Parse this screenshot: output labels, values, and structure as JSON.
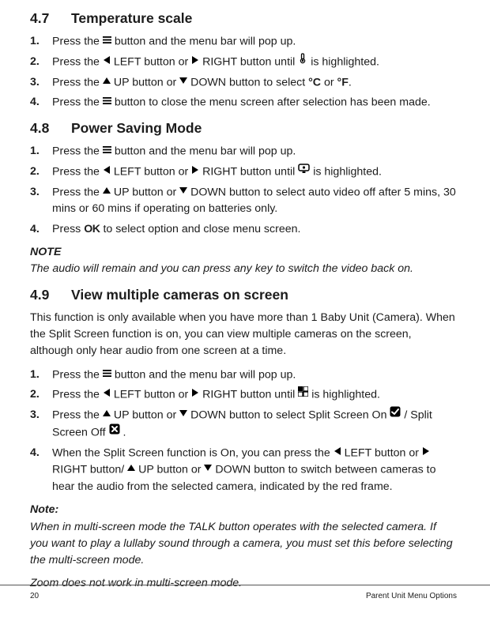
{
  "sections": {
    "s47": {
      "number": "4.7",
      "title": "Temperature scale",
      "steps": [
        {
          "n": "1.",
          "parts": [
            "Press the ",
            "menu-icon",
            " button and the menu bar will pop up."
          ]
        },
        {
          "n": "2.",
          "parts": [
            "Press the ",
            "left-icon",
            " LEFT button or ",
            "right-icon",
            " RIGHT button until  ",
            "thermo-icon",
            "  is highlighted."
          ]
        },
        {
          "n": "3.",
          "parts": [
            "Press the ",
            "up-icon",
            " UP button or ",
            "down-icon",
            " DOWN button to select ",
            "deg-c",
            " or ",
            "deg-f",
            "."
          ]
        },
        {
          "n": "4.",
          "parts": [
            "Press the ",
            "menu-icon",
            " button to close the menu screen after selection has been made."
          ]
        }
      ]
    },
    "s48": {
      "number": "4.8",
      "title": "Power Saving Mode",
      "steps": [
        {
          "n": "1.",
          "parts": [
            "Press the ",
            "menu-icon",
            " button and the menu bar will pop up."
          ]
        },
        {
          "n": "2.",
          "parts": [
            "Press the ",
            "left-icon",
            " LEFT button or ",
            "right-icon",
            " RIGHT button until  ",
            "monitor-icon",
            "  is highlighted."
          ]
        },
        {
          "n": "3.",
          "parts": [
            "Press the ",
            "up-icon",
            " UP button or ",
            "down-icon",
            " DOWN button to select auto video off after 5 mins, 30 mins or 60 mins if operating on batteries only."
          ]
        },
        {
          "n": "4.",
          "parts": [
            "Press ",
            "ok-icon",
            " to select option and close menu screen."
          ]
        }
      ],
      "note_hd": "NOTE",
      "note": "The audio will remain and you can press any key to switch the video back on."
    },
    "s49": {
      "number": "4.9",
      "title": "View multiple cameras on screen",
      "intro": "This function is only available when you have more than 1 Baby Unit (Camera). When the Split Screen function is on, you can view multiple cameras on the screen, although only hear audio from one screen at a time.",
      "steps": [
        {
          "n": "1.",
          "parts": [
            "Press the ",
            "menu-icon",
            " button and the menu bar will pop up."
          ]
        },
        {
          "n": "2.",
          "parts": [
            "Press the ",
            "left-icon",
            " LEFT button or ",
            "right-icon",
            " RIGHT button until  ",
            "grid-icon",
            " is highlighted."
          ]
        },
        {
          "n": "3.",
          "parts": [
            "Press the ",
            "up-icon",
            " UP button or ",
            "down-icon",
            " DOWN button to select Split Screen On  ",
            "check-on-icon",
            "  / Split Screen Off  ",
            "check-off-icon",
            " ."
          ]
        },
        {
          "n": "4.",
          "parts": [
            "When the Split Screen function is On, you can press the ",
            "left-icon",
            " LEFT button or ",
            "right-icon",
            " RIGHT button/ ",
            "up-icon",
            " UP button or ",
            "down-icon",
            " DOWN button to switch between cameras to hear the audio from the selected camera, indicated by the red frame."
          ]
        }
      ],
      "note_hd": "Note:",
      "note1": "When in multi-screen mode the TALK button operates with the selected camera. If you want to play a lullaby sound through a camera, you must set this before selecting the multi-screen mode.",
      "note2": "Zoom does not work in multi-screen mode."
    }
  },
  "deg_c": "°C",
  "deg_f": "°F",
  "ok_label": "OK",
  "footer_left": "20",
  "footer_right": "Parent Unit Menu Options"
}
